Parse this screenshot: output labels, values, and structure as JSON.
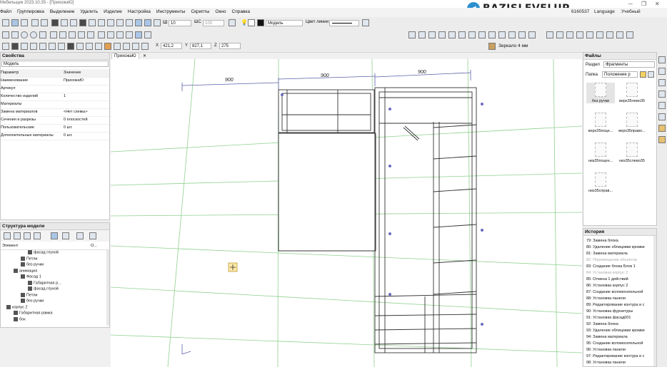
{
  "app": {
    "title": "Мебельщик 2023.10.35 - [ПрихожаЮ]"
  },
  "logo": {
    "text": "BAZISLEVELUP"
  },
  "menu": [
    "Файл",
    "Группировка",
    "Выделение",
    "Удалить",
    "Изделие",
    "Настройка",
    "Инструменты",
    "Скрипты",
    "Окно",
    "Справка"
  ],
  "topright": {
    "code": "6160537",
    "language": "Language",
    "mode": "Учебный"
  },
  "toolbar": {
    "size_value": "10",
    "step_label": "ШС",
    "step_value": "100",
    "layer_value": "Модель",
    "line_color_label": "Цвет линии",
    "coords": {
      "x_label": "X",
      "x_value": "421,2",
      "y_label": "Y",
      "y_value": "827,1",
      "z_label": "Z",
      "z_value": "275"
    },
    "material": "Зеркало 4 мм"
  },
  "properties": {
    "title": "Свойства",
    "object": "Модель",
    "col_param": "Параметр",
    "col_value": "Значение",
    "rows": [
      {
        "k": "Наименование",
        "v": "ПрихожаЮ"
      },
      {
        "k": "Артикул",
        "v": ""
      },
      {
        "k": "Количество изделий",
        "v": "1"
      },
      {
        "k": "Материалы",
        "v": ""
      },
      {
        "k": "Замена материалов",
        "v": "<Нет схемы>"
      },
      {
        "k": "Сечения и разрезы",
        "v": "0 плоскостей"
      },
      {
        "k": "Пользовательские",
        "v": "0 шт."
      },
      {
        "k": "Дополнительные материалы",
        "v": "0 шт."
      }
    ]
  },
  "structure": {
    "title": "Структура модели",
    "col1": "Элемент",
    "col2": "О...",
    "items": [
      {
        "label": "фасад глухой",
        "indent": 3
      },
      {
        "label": "Петли",
        "indent": 2
      },
      {
        "label": "без ручки",
        "indent": 2
      },
      {
        "label": "анимация",
        "indent": 1
      },
      {
        "label": "Фасад 1",
        "indent": 2
      },
      {
        "label": "Габаритная р...",
        "indent": 3
      },
      {
        "label": "фасад глухой",
        "indent": 3
      },
      {
        "label": "Петли",
        "indent": 2
      },
      {
        "label": "без ручки",
        "indent": 2
      },
      {
        "label": "корпус 2",
        "indent": 0
      },
      {
        "label": "Габаритная рамка",
        "indent": 1
      },
      {
        "label": "бок",
        "indent": 1
      }
    ]
  },
  "viewport": {
    "tab": "ПрихожаЮ",
    "dims": [
      "900",
      "900",
      "900"
    ]
  },
  "files": {
    "title": "Файлы",
    "section_label": "Раздел",
    "section_value": "Фрагменты",
    "folder_label": "Папка",
    "folder_value": "Положение р",
    "fragments": [
      "без ручки",
      "верх35лево35",
      "верх35поце...",
      "верх35право...",
      "низ35поцен...",
      "низ35слево35",
      "низ35справ..."
    ]
  },
  "history": {
    "title": "История",
    "items": [
      "79: Замена блока",
      "80: Удаление облицовки кромки",
      "81: Замена материала",
      "82: Перемещение объектов",
      "83: Создание блока Блок 1",
      "84: Установка корпус 2",
      "85: Отмена 1 действий",
      "86: Установка корпус 2",
      "87: Создание вспомогательной",
      "88: Установка панели",
      "89: Редактирование контура и с",
      "90: Установка фурнитуры",
      "91: Установка фасад001",
      "92: Замена блока",
      "93: Удаление облицовки кромки",
      "94: Замена материала",
      "95: Создание вспомогательной",
      "96: Установка панели",
      "97: Редактирование контура и с",
      "98: Установка панели"
    ]
  }
}
